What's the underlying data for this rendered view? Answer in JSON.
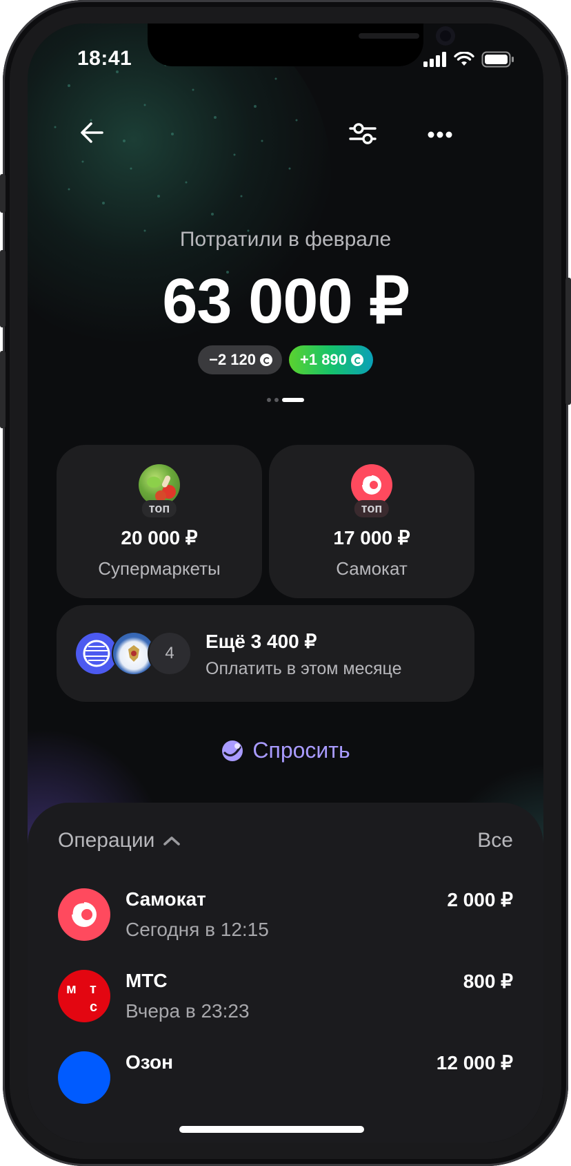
{
  "status": {
    "time": "18:41"
  },
  "hero": {
    "subtitle": "Потратили в феврале",
    "amount": "63 000 ₽",
    "chip_negative": "−2 120",
    "chip_positive": "+1 890",
    "pager_active_index": 2
  },
  "cards": [
    {
      "name": "supermarkets",
      "badge": "топ",
      "amount": "20 000 ₽",
      "label": "Супермаркеты"
    },
    {
      "name": "samokat",
      "badge": "топ",
      "amount": "17 000 ₽",
      "label": "Самокат"
    }
  ],
  "upcoming": {
    "extra_count": "4",
    "title": "Ещё 3 400 ₽",
    "subtitle": "Оплатить в этом месяце"
  },
  "ask": {
    "label": "Спросить"
  },
  "operations": {
    "title": "Операции",
    "all_label": "Все",
    "items": [
      {
        "title": "Самокат",
        "time": "Сегодня в 12:15",
        "amount": "2 000 ₽"
      },
      {
        "title": "МТС",
        "time": "Вчера в 23:23",
        "amount": "800 ₽"
      },
      {
        "title": "Озон",
        "time": "",
        "amount": "12 000 ₽"
      }
    ]
  },
  "colors": {
    "samokat": "#ff4a5e",
    "mts": "#e30611",
    "ozon": "#005bff",
    "accent_purple": "#a99bff"
  }
}
